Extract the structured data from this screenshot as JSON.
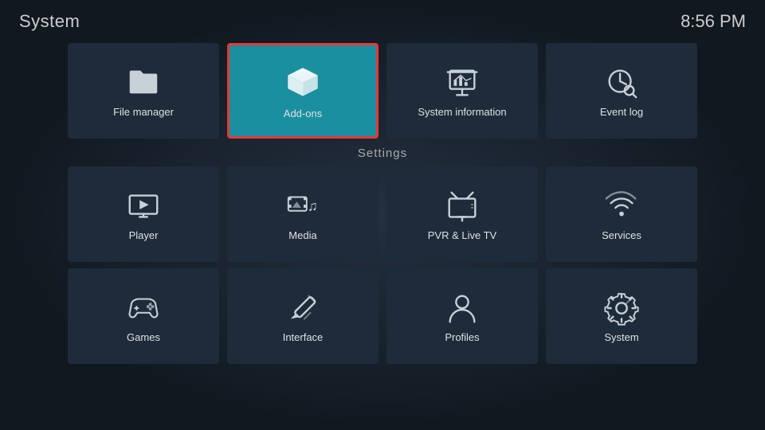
{
  "header": {
    "title": "System",
    "time": "8:56 PM"
  },
  "top_tiles": [
    {
      "id": "file-manager",
      "label": "File manager",
      "icon": "folder",
      "selected": false
    },
    {
      "id": "add-ons",
      "label": "Add-ons",
      "icon": "box",
      "selected": true
    },
    {
      "id": "system-information",
      "label": "System information",
      "icon": "chart",
      "selected": false
    },
    {
      "id": "event-log",
      "label": "Event log",
      "icon": "clock-search",
      "selected": false
    }
  ],
  "section_label": "Settings",
  "settings_tiles": [
    {
      "id": "player",
      "label": "Player",
      "icon": "play"
    },
    {
      "id": "media",
      "label": "Media",
      "icon": "media"
    },
    {
      "id": "pvr-live-tv",
      "label": "PVR & Live TV",
      "icon": "tv"
    },
    {
      "id": "services",
      "label": "Services",
      "icon": "wifi"
    },
    {
      "id": "games",
      "label": "Games",
      "icon": "gamepad"
    },
    {
      "id": "interface",
      "label": "Interface",
      "icon": "pencil"
    },
    {
      "id": "profiles",
      "label": "Profiles",
      "icon": "person"
    },
    {
      "id": "system",
      "label": "System",
      "icon": "gear"
    }
  ]
}
